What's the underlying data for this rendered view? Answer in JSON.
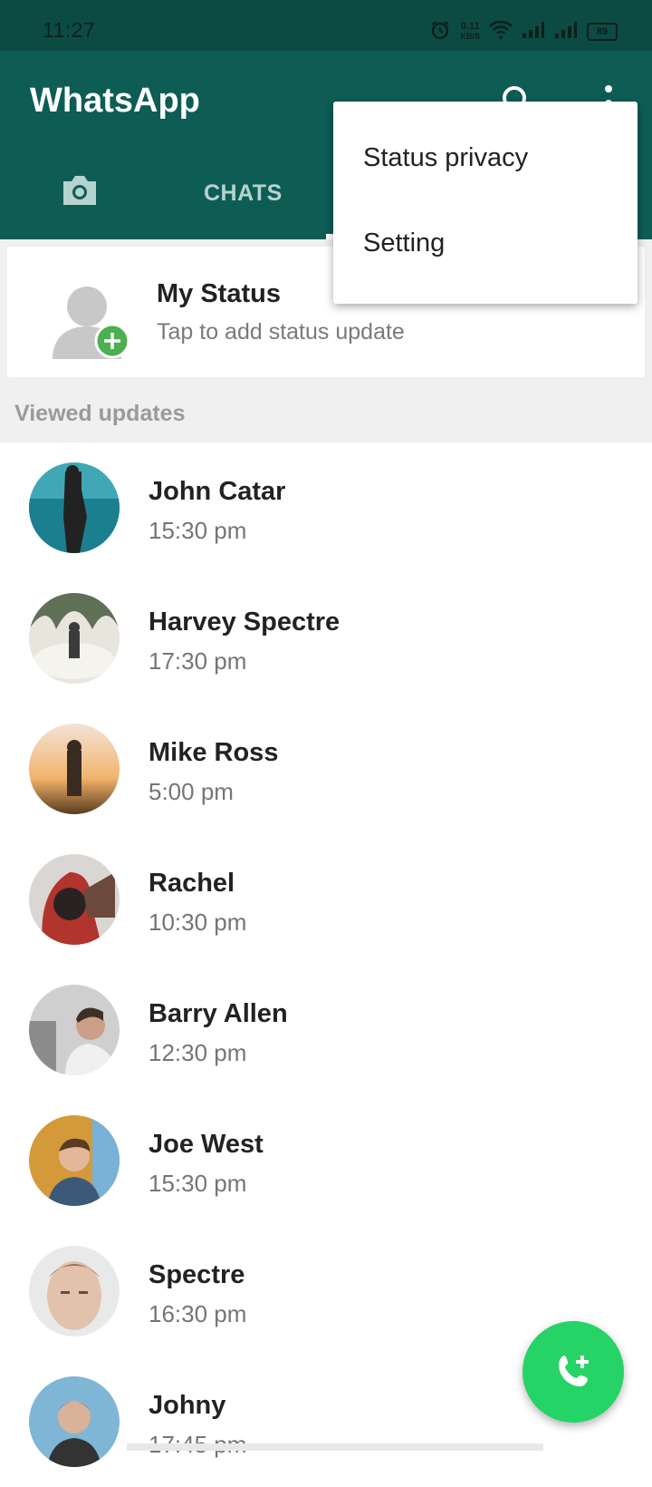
{
  "status_bar": {
    "time": "11:27",
    "speed_value": "0.11",
    "speed_unit": "KB/S",
    "battery": "89"
  },
  "app_bar": {
    "title": "WhatsApp",
    "tabs": [
      {
        "label": "CHATS"
      }
    ]
  },
  "overflow_menu": {
    "items": [
      "Status privacy",
      "Setting"
    ]
  },
  "my_status": {
    "title": "My Status",
    "subtitle": "Tap to add status update"
  },
  "section": {
    "viewed_updates": "Viewed updates"
  },
  "statuses": [
    {
      "name": "John Catar",
      "time": "15:30 pm",
      "color1": "#1e8a9c",
      "color2": "#2b2b2b"
    },
    {
      "name": "Harvey Spectre",
      "time": "17:30 pm",
      "color1": "#e8e6df",
      "color2": "#5b6a55"
    },
    {
      "name": "Mike Ross",
      "time": "5:00 pm",
      "color1": "#f2b46b",
      "color2": "#3a2b22"
    },
    {
      "name": "Rachel",
      "time": "10:30 pm",
      "color1": "#b1342d",
      "color2": "#2a2222"
    },
    {
      "name": "Barry Allen",
      "time": "12:30 pm",
      "color1": "#c9c9c9",
      "color2": "#3c3028"
    },
    {
      "name": "Joe West",
      "time": "15:30 pm",
      "color1": "#d49a3a",
      "color2": "#3b5a7a"
    },
    {
      "name": " Spectre",
      "time": "16:30 pm",
      "color1": "#e3c2ad",
      "color2": "#a56f57"
    },
    {
      "name": " Johny",
      "time": "17:45 pm",
      "color1": "#7fb6d6",
      "color2": "#333"
    }
  ],
  "colors": {
    "app_bar": "#0d5d55",
    "status_bar": "#0c4b44",
    "fab": "#25d366",
    "accent_plus": "#4caf50"
  }
}
